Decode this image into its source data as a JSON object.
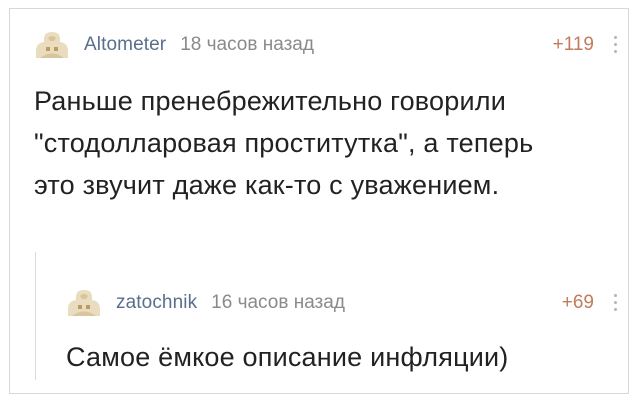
{
  "comments": [
    {
      "username": "Altometer",
      "time": "18 часов назад",
      "rating": "+119",
      "avatar_icon": "avatar-placeholder-icon",
      "text_lines": [
        "Раньше пренебрежительно говорили",
        "\"стодолларовая проститутка\", а теперь",
        "это звучит даже как-то с уважением."
      ]
    },
    {
      "username": "zatochnik",
      "time": "16 часов назад",
      "rating": "+69",
      "avatar_icon": "avatar-placeholder-icon",
      "text_lines": [
        "Самое ёмкое описание инфляции)"
      ]
    }
  ],
  "colors": {
    "username": "#5a6f8c",
    "time": "#8a8a8a",
    "rating": "#c37b5c",
    "text": "#222222",
    "avatar": "#e8d9b8"
  }
}
